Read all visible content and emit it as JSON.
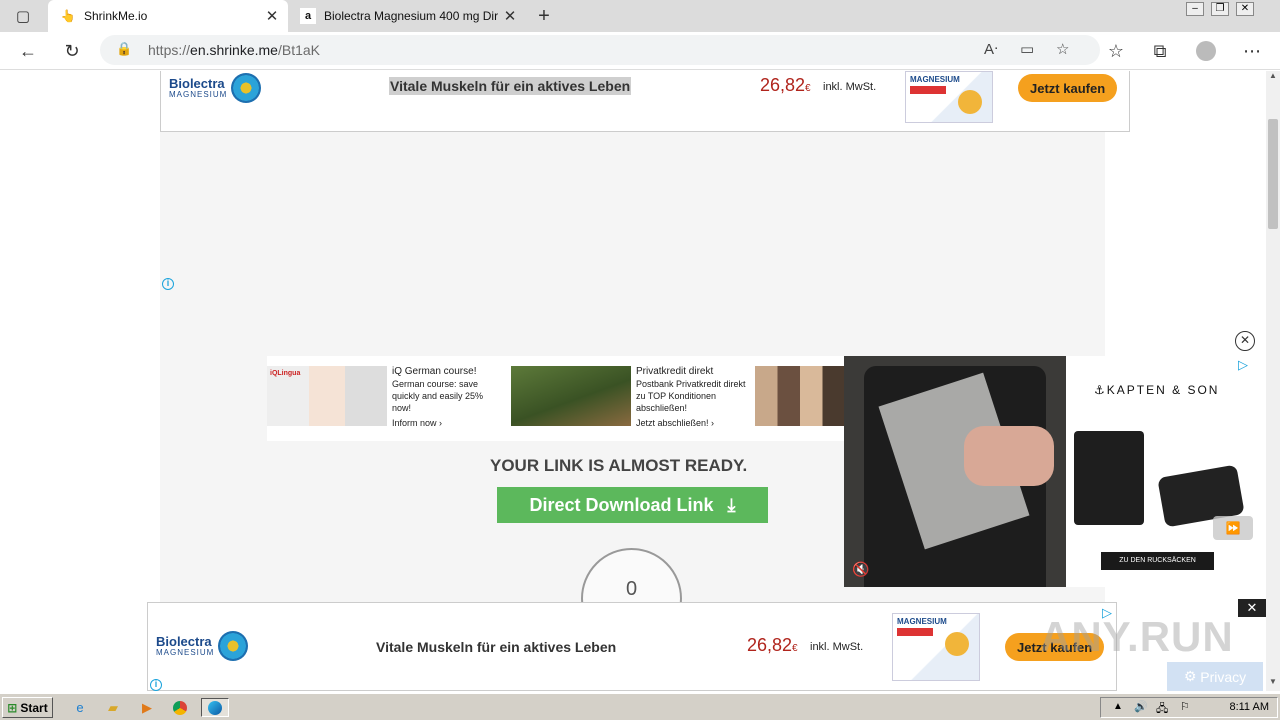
{
  "browser": {
    "tabs": [
      {
        "title": "ShrinkMe.io",
        "favicon": "hand-icon"
      },
      {
        "title": "Biolectra Magnesium 400 mg Dir",
        "favicon": "amazon-icon"
      }
    ],
    "url_prefix": "https://",
    "url_host": "en.shrinke.me",
    "url_path": "/Bt1aK"
  },
  "top_ad": {
    "brand": "Biolectra",
    "brand_sub": "MAGNESIUM",
    "slogan": "Vitale Muskeln für ein aktives Leben",
    "price": "26,82",
    "currency": "€",
    "tax_note": "inkl. MwSt.",
    "pack_label": "MAGNESIUM",
    "cta": "Jetzt kaufen"
  },
  "ads": [
    {
      "title": "iQ German course!",
      "body": "German course: save quickly and easily 25% now!",
      "cta": "Inform now",
      "brand": "iQLingua"
    },
    {
      "title": "Privatkredit direkt",
      "body": "Postbank Privatkredit direkt zu TOP Konditionen abschließen!",
      "cta": "Jetzt abschließen!"
    }
  ],
  "main": {
    "heading": "YOUR LINK IS ALMOST READY.",
    "download_label": "Direct Download Link",
    "countdown": "0"
  },
  "video_ad": {
    "brand": "⚓KAPTEN & SON",
    "cta": "ZU DEN RUCKSÄCKEN"
  },
  "bottom_ad": {
    "brand": "Biolectra",
    "brand_sub": "MAGNESIUM",
    "slogan": "Vitale Muskeln für ein aktives Leben",
    "price": "26,82",
    "currency": "€",
    "tax_note": "inkl. MwSt.",
    "pack_label": "MAGNESIUM",
    "cta": "Jetzt kaufen"
  },
  "overlay": {
    "watermark": "ANY.RUN",
    "privacy": "Privacy"
  },
  "taskbar": {
    "start": "Start",
    "clock": "8:11 AM"
  },
  "colors": {
    "download_green": "#5cb85c",
    "price_red": "#b0241c",
    "cta_orange": "#f5a01e",
    "info_blue": "#1aa3dc"
  }
}
